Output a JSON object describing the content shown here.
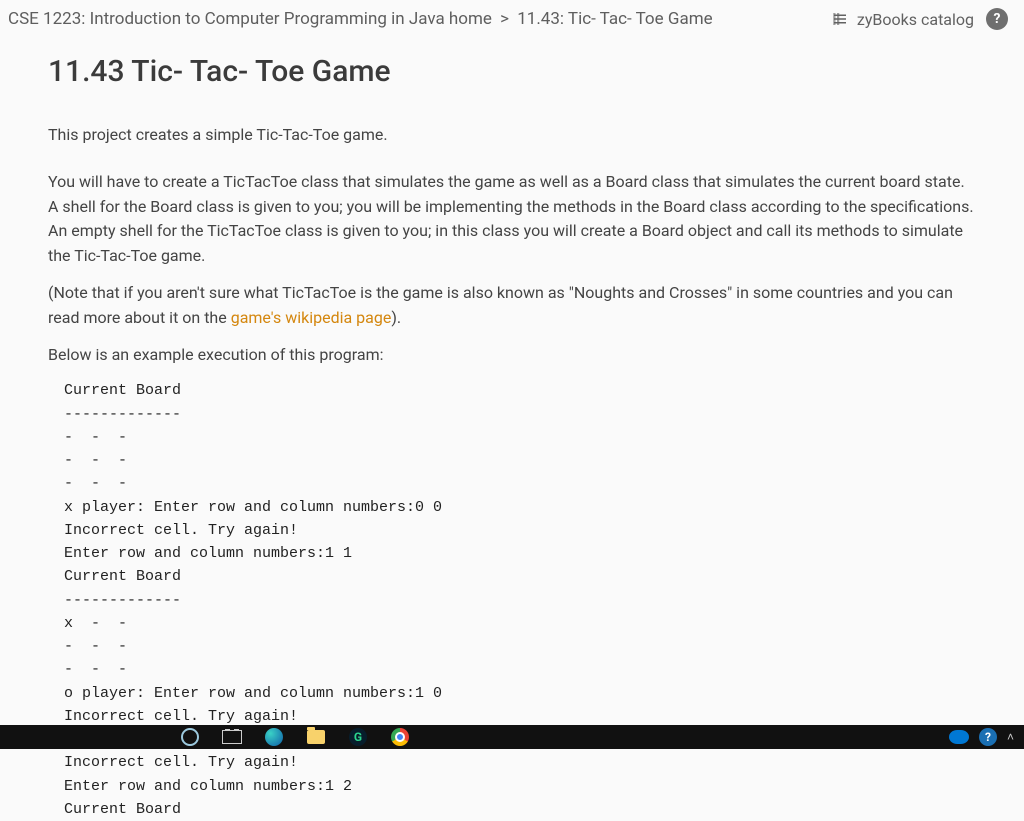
{
  "breadcrumb": {
    "course": "CSE 1223: Introduction to Computer Programming in Java home",
    "sep": ">",
    "page": "11.43: Tic- Tac- Toe Game"
  },
  "topbar": {
    "catalog_label": "zyBooks catalog",
    "help_label": "?"
  },
  "page": {
    "title": "11.43 Tic- Tac- Toe Game",
    "intro": "This project creates a simple Tic-Tac-Toe game.",
    "para1": "You will have to create a TicTacToe class that simulates the game as well as a Board class that simulates the current board state. A shell for the Board class is given to you; you will be implementing the methods in the Board class according to the specifications. An empty shell for the TicTacToe class is given to you; in this class you will create a Board object and call its methods to simulate the Tic-Tac-Toe game.",
    "para2_a": "(Note that if you aren't sure what TicTacToe is the game is also known as \"Noughts and Crosses\" in some countries and you can read more about it on the ",
    "wiki_text": "game's wikipedia page",
    "para2_b": ").",
    "para3": "Below is an example execution of this program:",
    "code": "Current Board\n-------------\n-  -  -\n-  -  -\n-  -  -\nx player: Enter row and column numbers:0 0\nIncorrect cell. Try again!\nEnter row and column numbers:1 1\nCurrent Board\n-------------\nx  -  -\n-  -  -\n-  -  -\no player: Enter row and column numbers:1 0\nIncorrect cell. Try again!\nEnter row and column numbers:0 1\nIncorrect cell. Try again!\nEnter row and column numbers:1 2\nCurrent Board"
  },
  "tray": {
    "help": "?",
    "caret": "˄"
  }
}
